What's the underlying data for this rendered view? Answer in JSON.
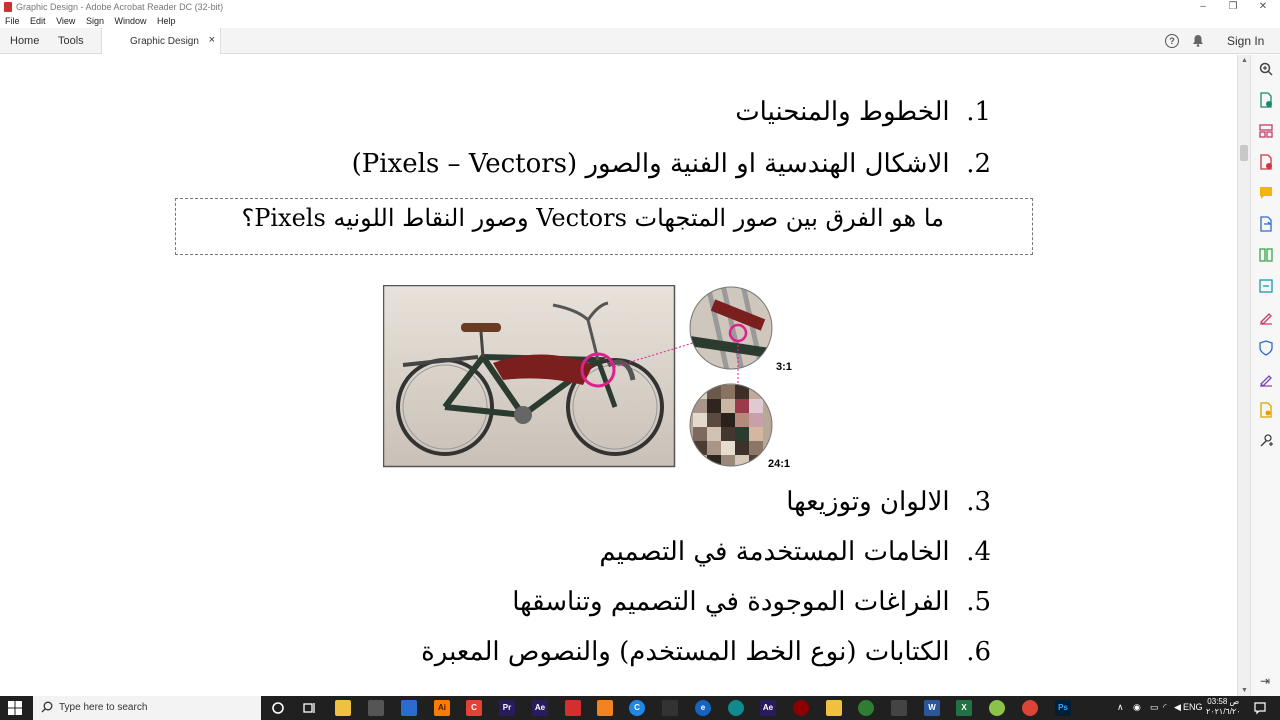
{
  "window": {
    "title": "Graphic Design - Adobe Acrobat Reader DC (32-bit)",
    "controls": [
      "–",
      "❐",
      "✕"
    ]
  },
  "menu": [
    "File",
    "Edit",
    "View",
    "Sign",
    "Window",
    "Help"
  ],
  "tabs": {
    "home": "Home",
    "tools": "Tools",
    "document": "Graphic Design",
    "close": "×"
  },
  "header": {
    "help": "?",
    "signin": "Sign In"
  },
  "document": {
    "items": [
      {
        "num": "1.",
        "text": "الخطوط والمنحنيات"
      },
      {
        "num": "2.",
        "text": "الاشكال الهندسية او الفنية والصور (Pixels – Vectors)"
      },
      {
        "num": "3.",
        "text": "الالوان وتوزيعها"
      },
      {
        "num": "4.",
        "text": "الخامات المستخدمة في التصميم"
      },
      {
        "num": "5.",
        "text": "الفراغات الموجودة في التصميم وتناسقها"
      },
      {
        "num": "6.",
        "text": "الكتابات (نوع الخط المستخدم) والنصوص المعبرة"
      }
    ],
    "question": "ما هو الفرق بين صور المتجهات Vectors وصور النقاط اللونيه Pixels؟",
    "figure": {
      "zoom_small": "3:1",
      "zoom_large": "24:1"
    }
  },
  "taskbar": {
    "search_placeholder": "Type here to search",
    "language": "ENG",
    "time": "03:58 ص",
    "date": "٢٠٢١/٦/٢٠"
  },
  "colors": {
    "accent_red": "#d32f2f",
    "taskbar_bg": "#202020",
    "highlight_pink": "#e0208c"
  }
}
